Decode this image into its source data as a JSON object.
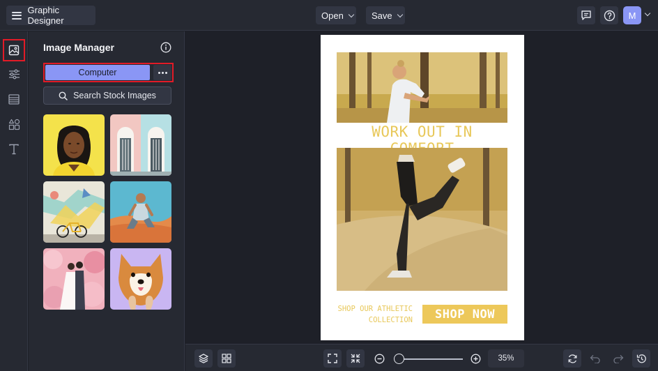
{
  "app": {
    "title": "Graphic Designer"
  },
  "toolbar": {
    "open_label": "Open",
    "save_label": "Save",
    "user_initial": "M"
  },
  "rail": {
    "items": [
      "image-manager",
      "adjustments",
      "background",
      "shapes",
      "text"
    ],
    "active": "image-manager"
  },
  "panel": {
    "title": "Image Manager",
    "source_button": "Computer",
    "stock_button": "Search Stock Images",
    "thumbnails": [
      "woman-portrait",
      "doorways",
      "bicycle-mural",
      "man-sitting-desert",
      "wedding-couple",
      "shiba-dog"
    ]
  },
  "poster": {
    "headline": "WORK OUT IN COMFORT",
    "tagline_line1": "SHOP OUR ATHLETIC",
    "tagline_line2": "COLLECTION",
    "cta": "SHOP NOW",
    "accent_color": "#edc85a"
  },
  "zoom": {
    "percent": 35,
    "label": "35%"
  },
  "colors": {
    "background": "#1e2028",
    "panel": "#262932",
    "accent": "#8a96f5",
    "highlight": "#e21b27"
  }
}
